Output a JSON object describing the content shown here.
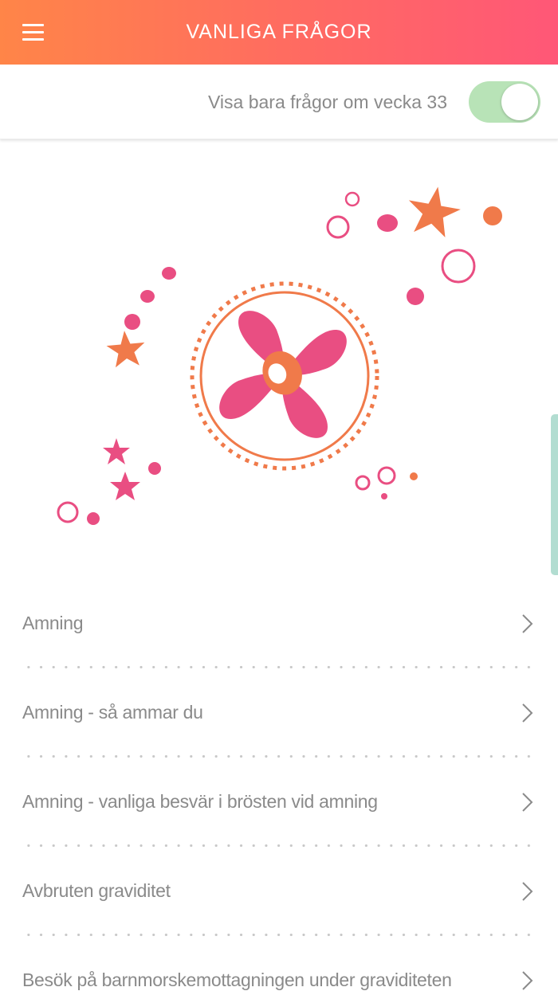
{
  "header": {
    "title": "VANLIGA FRÅGOR",
    "menu_icon": "hamburger-menu-icon"
  },
  "filter": {
    "label": "Visa bara frågor om vecka 33",
    "toggle_on": true,
    "toggle_color": "#b8e3b7"
  },
  "colors": {
    "header_gradient_start": "#ff8548",
    "header_gradient_end": "#ff5777",
    "pink": "#e94e82",
    "orange": "#f07a4a",
    "text": "#8a8a8a"
  },
  "faq": {
    "items": [
      {
        "label": "Amning"
      },
      {
        "label": "Amning - så ammar du"
      },
      {
        "label": "Amning - vanliga besvär i brösten vid amning"
      },
      {
        "label": "Avbruten graviditet"
      },
      {
        "label": "Besök på barnmorskemottagningen under graviditeten"
      }
    ]
  }
}
